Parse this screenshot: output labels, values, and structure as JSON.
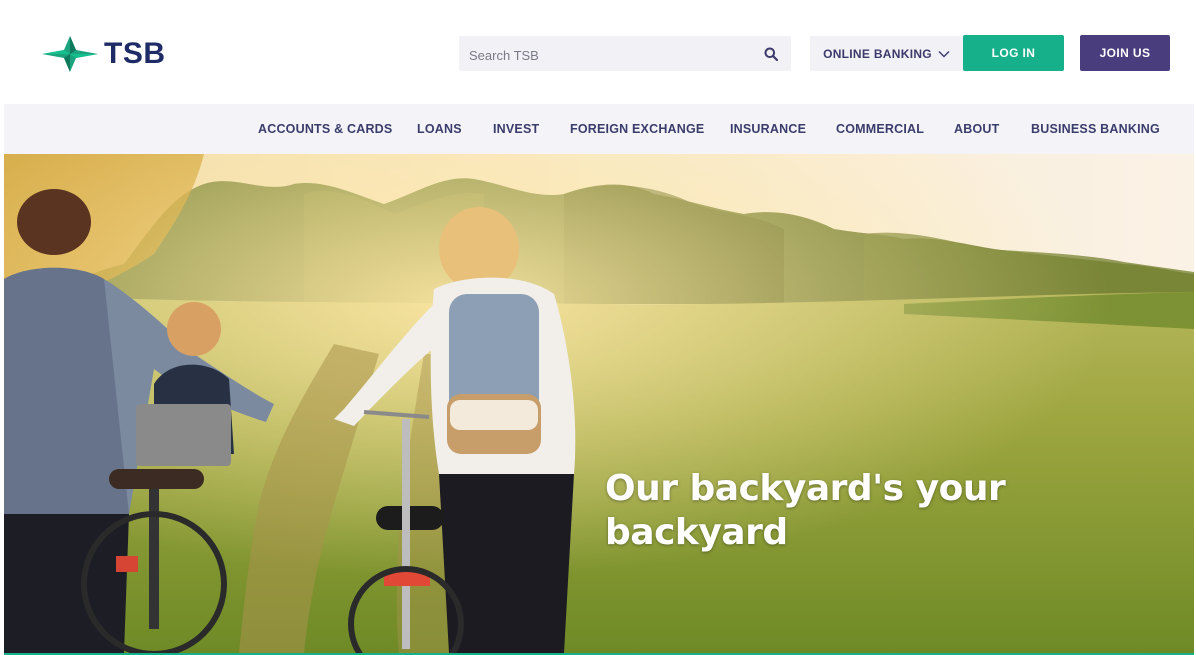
{
  "brand": {
    "name": "TSB",
    "logo_icon": "tsb-star-logo",
    "color_primary": "#1e2b66",
    "color_accent": "#16b08a",
    "color_join": "#4a3d7e"
  },
  "header": {
    "search": {
      "placeholder": "Search TSB",
      "icon": "search-icon"
    },
    "online_banking_label": "ONLINE BANKING",
    "login_label": "LOG IN",
    "join_label": "JOIN US"
  },
  "nav": {
    "items": [
      {
        "label": "ACCOUNTS & CARDS"
      },
      {
        "label": "LOANS"
      },
      {
        "label": "INVEST"
      },
      {
        "label": "FOREIGN EXCHANGE"
      },
      {
        "label": "INSURANCE"
      },
      {
        "label": "COMMERCIAL"
      },
      {
        "label": "ABOUT"
      },
      {
        "label": "BUSINESS BANKING"
      }
    ]
  },
  "hero": {
    "headline": "Our backyard's your backyard"
  }
}
